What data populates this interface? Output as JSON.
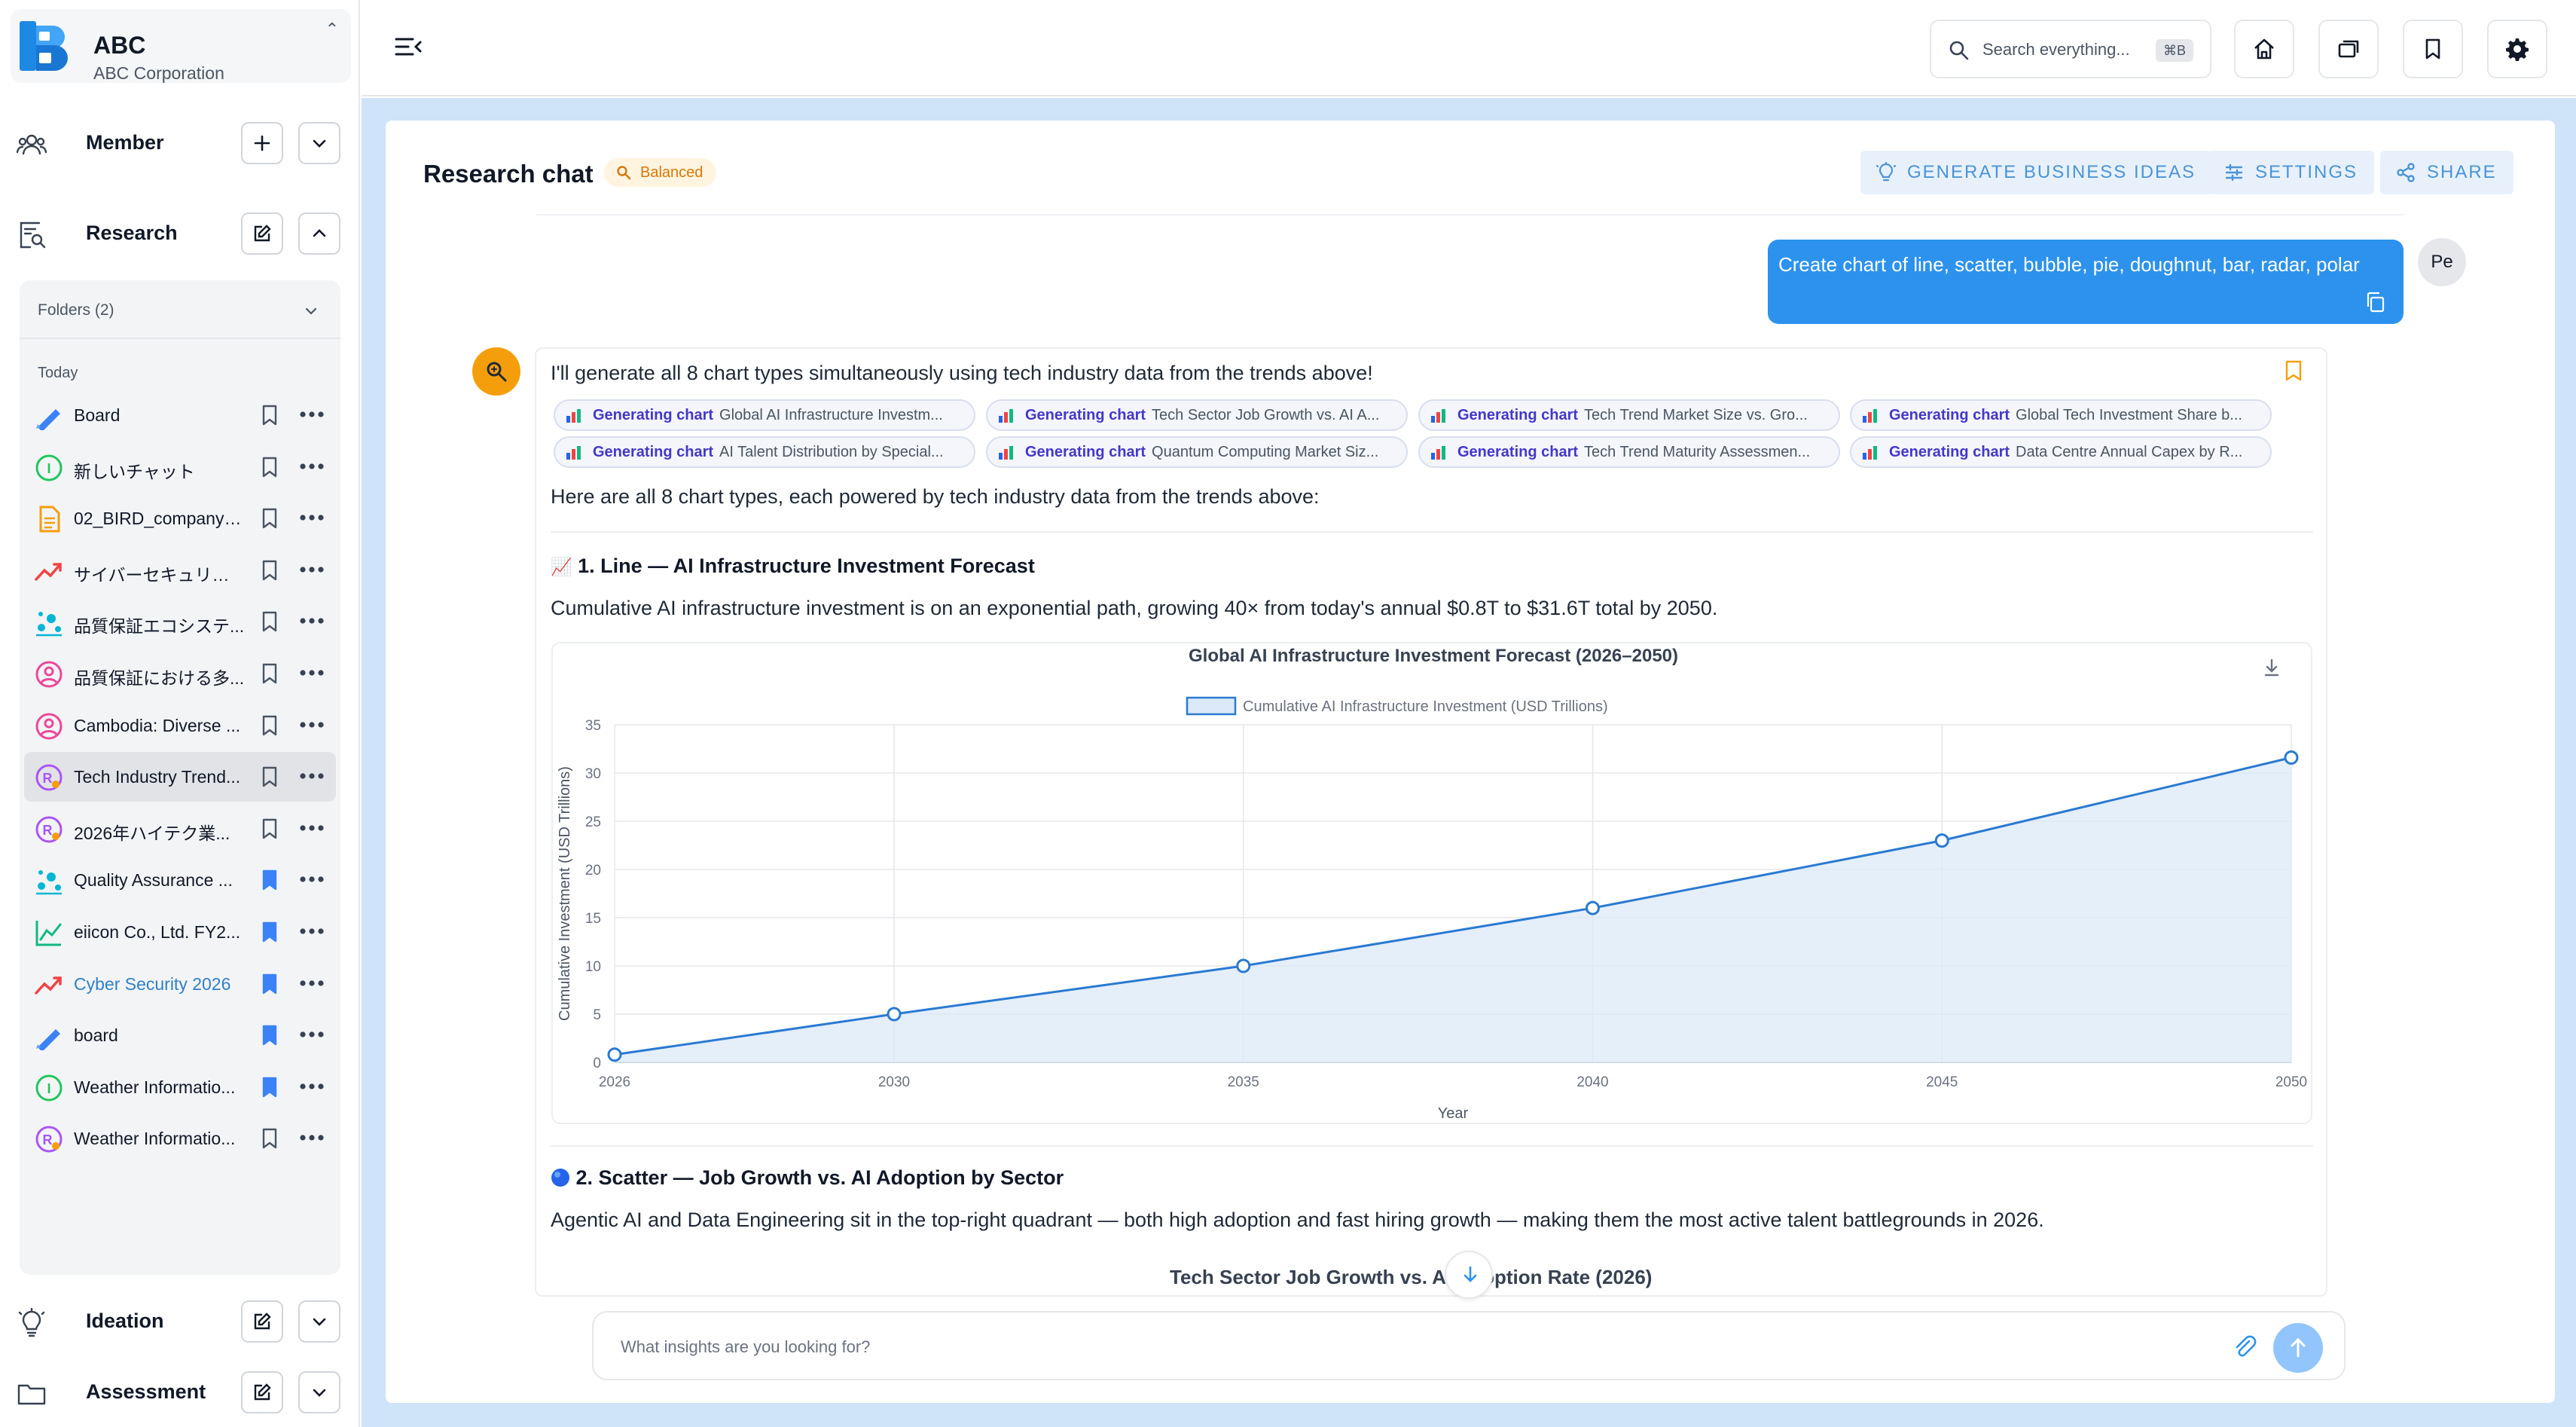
{
  "brand": {
    "name": "ABC",
    "subtitle": "ABC Corporation",
    "logo_letter": "B"
  },
  "sidebar": {
    "sections": [
      {
        "label": "Member",
        "icon": "users-icon"
      },
      {
        "label": "Research",
        "icon": "research-icon"
      },
      {
        "label": "Ideation",
        "icon": "lightbulb-icon"
      },
      {
        "label": "Assessment",
        "icon": "folder-icon"
      }
    ],
    "folders_label": "Folders (2)",
    "today_label": "Today",
    "items": [
      {
        "label": "Board",
        "icon": "pen-icon",
        "bookmarked": false
      },
      {
        "label": "新しいチャット",
        "icon": "ideation-circle-icon",
        "bookmarked": false
      },
      {
        "label": "02_BIRD_company_...",
        "icon": "document-icon",
        "bookmarked": false
      },
      {
        "label": "サイバーセキュリティ",
        "icon": "trend-icon",
        "bookmarked": false
      },
      {
        "label": "品質保証エコシステ...",
        "icon": "scatter-icon",
        "bookmarked": false
      },
      {
        "label": "品質保証における多...",
        "icon": "person-circle-icon",
        "bookmarked": false
      },
      {
        "label": "Cambodia: Diverse ...",
        "icon": "person-circle-icon",
        "bookmarked": false
      },
      {
        "label": "Tech Industry Trend...",
        "icon": "research-circle-icon",
        "bookmarked": false,
        "active": true
      },
      {
        "label": "2026年ハイテク業...",
        "icon": "research-circle-icon",
        "bookmarked": false
      },
      {
        "label": "Quality Assurance ...",
        "icon": "scatter-icon",
        "bookmarked": true
      },
      {
        "label": "eiicon Co., Ltd. FY2...",
        "icon": "line-chart-icon",
        "bookmarked": true
      },
      {
        "label": "Cyber Security 2026",
        "icon": "trend-icon",
        "bookmarked": true,
        "link": true
      },
      {
        "label": "board",
        "icon": "pen-icon",
        "bookmarked": true
      },
      {
        "label": "Weather Informatio...",
        "icon": "ideation-circle-icon",
        "bookmarked": true
      },
      {
        "label": "Weather Informatio...",
        "icon": "research-circle-icon",
        "bookmarked": false
      }
    ]
  },
  "topbar": {
    "search_placeholder": "Search everything...",
    "search_shortcut": "⌘B"
  },
  "main": {
    "title": "Research chat",
    "mode_badge": "Balanced",
    "actions": {
      "generate_ideas": "GENERATE BUSINESS IDEAS",
      "settings": "SETTINGS",
      "share": "SHARE"
    },
    "user_message": "Create chart of line, scatter, bubble, pie, doughnut, bar, radar, polar",
    "user_avatar": "Pe",
    "ai_intro": "I'll generate all 8 chart types simultaneously using tech industry data from the trends above!",
    "chips_prefix": "Generating chart",
    "chips": [
      "Global AI Infrastructure Investm...",
      "Tech Sector Job Growth vs. AI A...",
      "Tech Trend Market Size vs. Gro...",
      "Global Tech Investment Share b...",
      "AI Talent Distribution by Special...",
      "Quantum Computing Market Siz...",
      "Tech Trend Maturity Assessmen...",
      "Data Centre Annual Capex by R..."
    ],
    "summary": "Here are all 8 chart types, each powered by tech industry data from the trends above:",
    "section1_heading": "1. Line — AI Infrastructure Investment Forecast",
    "section1_emoji": "📈",
    "section1_text": "Cumulative AI infrastructure investment is on an exponential path, growing 40× from today's annual $0.8T to $31.6T total by 2050.",
    "section2_heading": "2. Scatter — Job Growth vs. AI Adoption by Sector",
    "section2_text": "Agentic AI and Data Engineering sit in the top-right quadrant — both high adoption and fast hiring growth — making them the most active talent battlegrounds in 2026.",
    "section2_chart_title": "Tech Sector Job Growth vs. AI Adoption Rate (2026)",
    "composer_placeholder": "What insights are you looking for?"
  },
  "colors": {
    "accent": "#2c92ed",
    "chart_line": "#2a7ad2",
    "chart_fill": "#dbe9f8",
    "badge": "#d97706"
  },
  "chart_data": {
    "type": "line",
    "title": "Global AI Infrastructure Investment Forecast (2026–2050)",
    "xlabel": "Year",
    "ylabel": "Cumulative Investment (USD Trillions)",
    "ylim": [
      0,
      35
    ],
    "yticks": [
      0,
      5,
      10,
      15,
      20,
      25,
      30,
      35
    ],
    "x": [
      2026,
      2030,
      2035,
      2040,
      2045,
      2050
    ],
    "series": [
      {
        "name": "Cumulative AI Infrastructure Investment (USD Trillions)",
        "values": [
          0.8,
          5,
          10,
          16,
          23,
          31.6
        ]
      }
    ],
    "legend": "top-center",
    "grid": true,
    "fill": true
  }
}
